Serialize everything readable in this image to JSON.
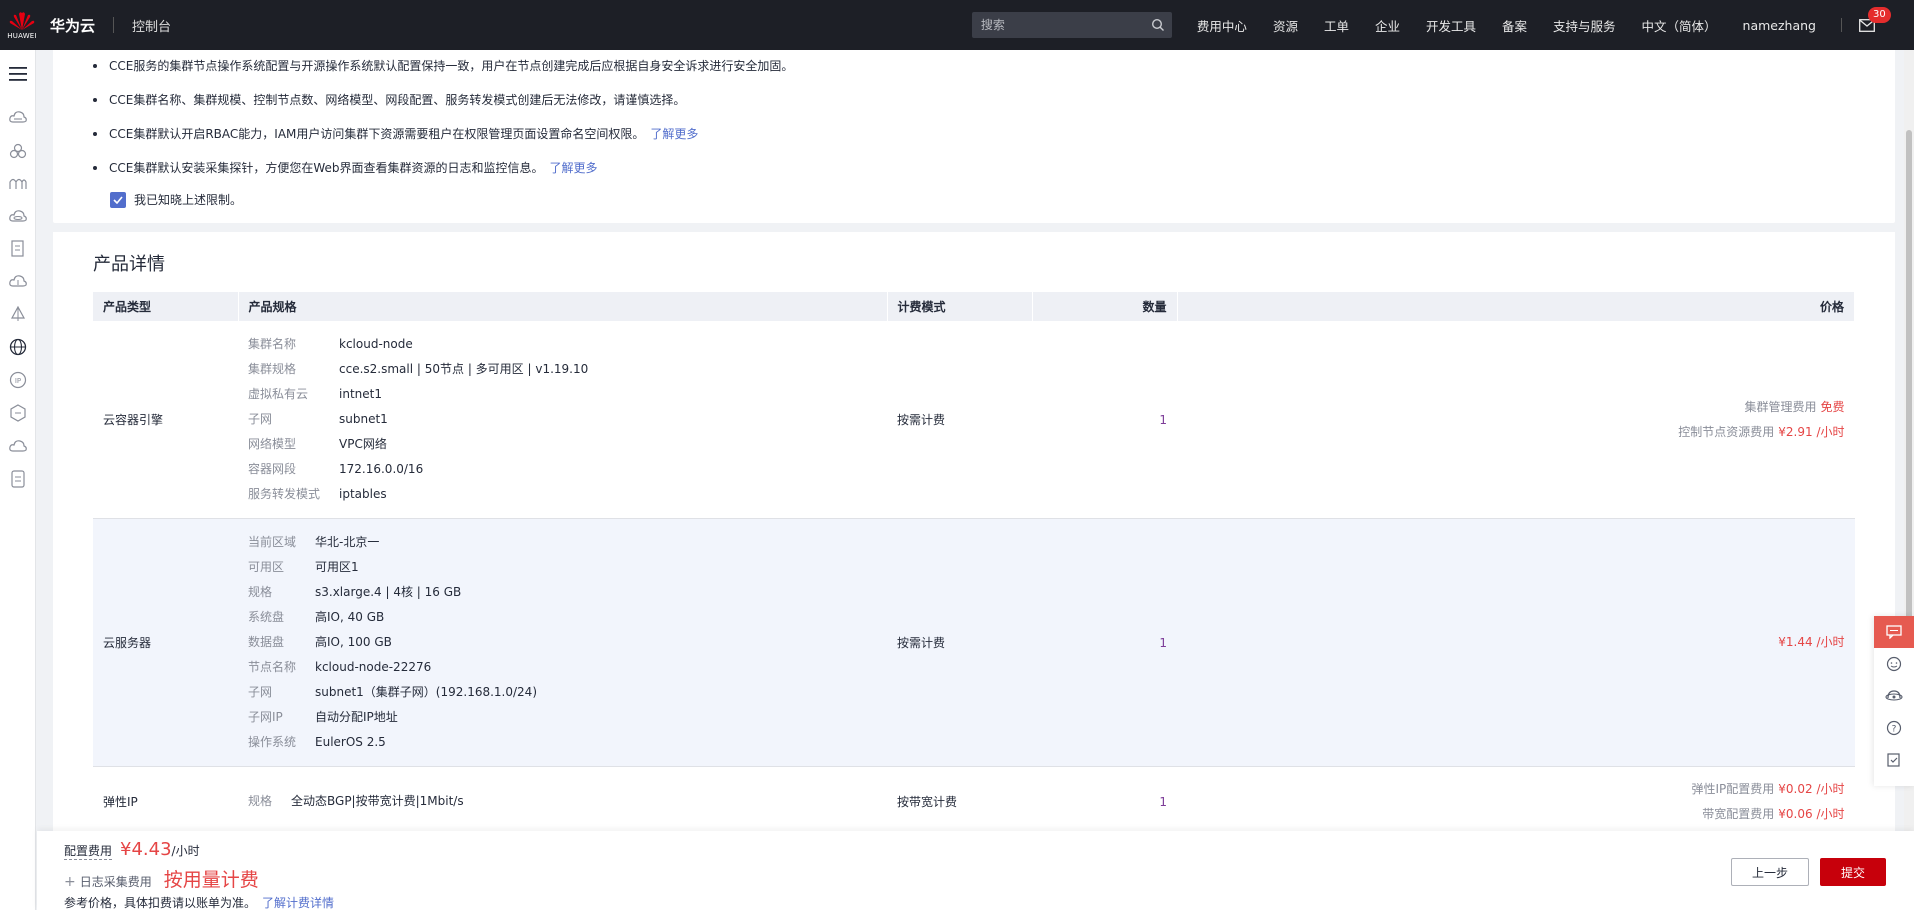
{
  "header": {
    "logo_text": "HUAWEI",
    "brand": "华为云",
    "console": "控制台",
    "search_placeholder": "搜索",
    "nav": [
      "费用中心",
      "资源",
      "工单",
      "企业",
      "开发工具",
      "备案",
      "支持与服务",
      "中文（简体）",
      "namezhang"
    ],
    "mail_count": "30"
  },
  "notice": {
    "items": [
      {
        "text": "CCE服务的集群节点操作系统配置与开源操作系统默认配置保持一致，用户在节点创建完成后应根据自身安全诉求进行安全加固。",
        "link": ""
      },
      {
        "text": "CCE集群名称、集群规模、控制节点数、网络模型、网段配置、服务转发模式创建后无法修改，请谨慎选择。",
        "link": ""
      },
      {
        "text": "CCE集群默认开启RBAC能力，IAM用户访问集群下资源需要租户在权限管理页面设置命名空间权限。",
        "link": "了解更多"
      },
      {
        "text": "CCE集群默认安装采集探针，方便您在Web界面查看集群资源的日志和监控信息。",
        "link": "了解更多"
      }
    ],
    "agree_label": "我已知晓上述限制。"
  },
  "details": {
    "title": "产品详情",
    "columns": [
      "产品类型",
      "产品规格",
      "计费模式",
      "数量",
      "价格"
    ],
    "rows": [
      {
        "type": "云容器引擎",
        "specs": [
          {
            "k": "集群名称",
            "v": "kcloud-node"
          },
          {
            "k": "集群规格",
            "v": "cce.s2.small | 50节点 | 多可用区 | v1.19.10"
          },
          {
            "k": "虚拟私有云",
            "v": "intnet1"
          },
          {
            "k": "子网",
            "v": "subnet1"
          },
          {
            "k": "网络模型",
            "v": "VPC网络"
          },
          {
            "k": "容器网段",
            "v": "172.16.0.0/16"
          },
          {
            "k": "服务转发模式",
            "v": "iptables"
          }
        ],
        "billing": "按需计费",
        "qty": "1",
        "prices": [
          {
            "label": "集群管理费用",
            "value": "免费"
          },
          {
            "label": "控制节点资源费用",
            "value": "¥2.91 /小时"
          }
        ]
      },
      {
        "type": "云服务器",
        "specs": [
          {
            "k": "当前区域",
            "v": "华北-北京一"
          },
          {
            "k": "可用区",
            "v": "可用区1"
          },
          {
            "k": "规格",
            "v": "s3.xlarge.4 | 4核 | 16 GB"
          },
          {
            "k": "系统盘",
            "v": "高IO, 40 GB"
          },
          {
            "k": "数据盘",
            "v": "高IO, 100 GB"
          },
          {
            "k": "节点名称",
            "v": "kcloud-node-22276"
          },
          {
            "k": "子网",
            "v": "subnet1（集群子网）(192.168.1.0/24)"
          },
          {
            "k": "子网IP",
            "v": "自动分配IP地址"
          },
          {
            "k": "操作系统",
            "v": "EulerOS 2.5"
          }
        ],
        "billing": "按需计费",
        "qty": "1",
        "prices": [
          {
            "label": "",
            "value": "¥1.44 /小时"
          }
        ]
      },
      {
        "type": "弹性IP",
        "specs": [
          {
            "k": "规格",
            "v": "全动态BGP|按带宽计费|1Mbit/s"
          }
        ],
        "billing": "按带宽计费",
        "qty": "1",
        "prices": [
          {
            "label": "弹性IP配置费用",
            "value": "¥0.02 /小时"
          },
          {
            "label": "带宽配置费用",
            "value": "¥0.06 /小时"
          }
        ]
      }
    ]
  },
  "footer": {
    "config_label": "配置费用",
    "config_price": "¥4.43",
    "config_unit": "/小时",
    "log_label": "日志采集费用",
    "log_price": "按用量计费",
    "note": "参考价格，具体扣费请以账单为准。",
    "note_link": "了解计费详情",
    "prev_label": "上一步",
    "submit_label": "提交"
  },
  "colors": {
    "topbar": "#1d1f26",
    "accent": "#526ecc",
    "price": "#e54545",
    "submit": "#c7000b"
  }
}
